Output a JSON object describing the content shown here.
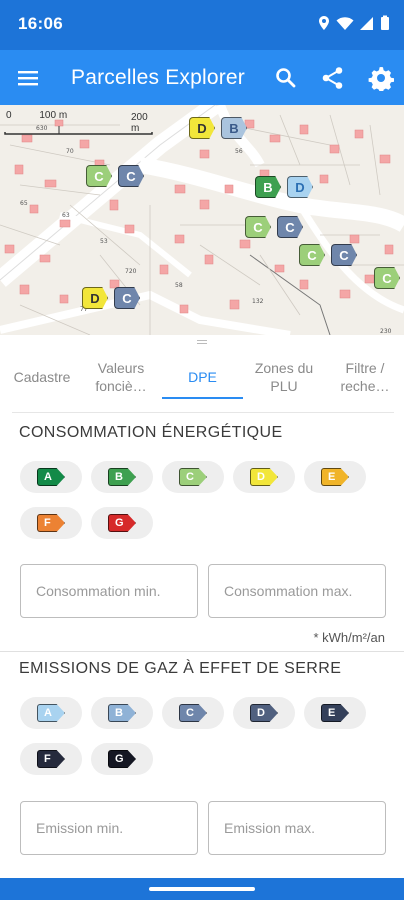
{
  "status": {
    "time": "16:06"
  },
  "appbar": {
    "title": "Parcelles Explorer"
  },
  "map": {
    "scale_small": "0",
    "scale_top": "100 m",
    "scale_bottom": "200 m",
    "markers": [
      {
        "label": "D",
        "color": "#f2e63a",
        "text_color": "#333"
      },
      {
        "label": "B",
        "color": "#aac4de",
        "text_color": "#3a5a8a"
      },
      {
        "label": "C",
        "color": "#9ccf7a",
        "text_color": "#ffffff"
      },
      {
        "label": "C",
        "color": "#6f86ab",
        "text_color": "#ffffff"
      },
      {
        "label": "B",
        "color": "#3ea050",
        "text_color": "#ffffff"
      },
      {
        "label": "D",
        "color": "#a9d3f0",
        "text_color": "#2b6fb3"
      },
      {
        "label": "C",
        "color": "#9ccf7a",
        "text_color": "#ffffff"
      },
      {
        "label": "C",
        "color": "#6f86ab",
        "text_color": "#ffffff"
      },
      {
        "label": "C",
        "color": "#9ccf7a",
        "text_color": "#ffffff"
      },
      {
        "label": "C",
        "color": "#6f86ab",
        "text_color": "#ffffff"
      },
      {
        "label": "C",
        "color": "#9ccf7a",
        "text_color": "#ffffff"
      },
      {
        "label": "D",
        "color": "#f2e63a",
        "text_color": "#333"
      },
      {
        "label": "C",
        "color": "#6f86ab",
        "text_color": "#ffffff"
      }
    ]
  },
  "tabs": [
    {
      "label": "Cadastre",
      "active": false
    },
    {
      "label": "Valeurs fonciè…",
      "active": false
    },
    {
      "label": "DPE",
      "active": true
    },
    {
      "label": "Zones du PLU",
      "active": false
    },
    {
      "label": "Filtre / reche…",
      "active": false
    }
  ],
  "energy": {
    "title": "CONSOMMATION ÉNERGÉTIQUE",
    "classes": [
      {
        "label": "A",
        "color": "#138a48",
        "text": "#ffffff"
      },
      {
        "label": "B",
        "color": "#3ea050",
        "text": "#ffffff"
      },
      {
        "label": "C",
        "color": "#9ccf7a",
        "text": "#ffffff"
      },
      {
        "label": "D",
        "color": "#f2e63a",
        "text": "#ffffff"
      },
      {
        "label": "E",
        "color": "#f0b429",
        "text": "#ffffff"
      },
      {
        "label": "F",
        "color": "#ec8233",
        "text": "#ffffff"
      },
      {
        "label": "G",
        "color": "#d62a2a",
        "text": "#ffffff"
      }
    ],
    "min_placeholder": "Consommation min.",
    "max_placeholder": "Consommation max.",
    "unit": "* kWh/m²/an"
  },
  "ges": {
    "title": "EMISSIONS DE GAZ À EFFET DE SERRE",
    "classes": [
      {
        "label": "A",
        "color": "#a9d3f0",
        "text": "#ffffff"
      },
      {
        "label": "B",
        "color": "#8fb2d6",
        "text": "#ffffff"
      },
      {
        "label": "C",
        "color": "#6f86ab",
        "text": "#ffffff"
      },
      {
        "label": "D",
        "color": "#50607f",
        "text": "#ffffff"
      },
      {
        "label": "E",
        "color": "#34405a",
        "text": "#ffffff"
      },
      {
        "label": "F",
        "color": "#252a3c",
        "text": "#ffffff"
      },
      {
        "label": "G",
        "color": "#151723",
        "text": "#ffffff"
      }
    ],
    "min_placeholder": "Emission min.",
    "max_placeholder": "Emission max."
  }
}
